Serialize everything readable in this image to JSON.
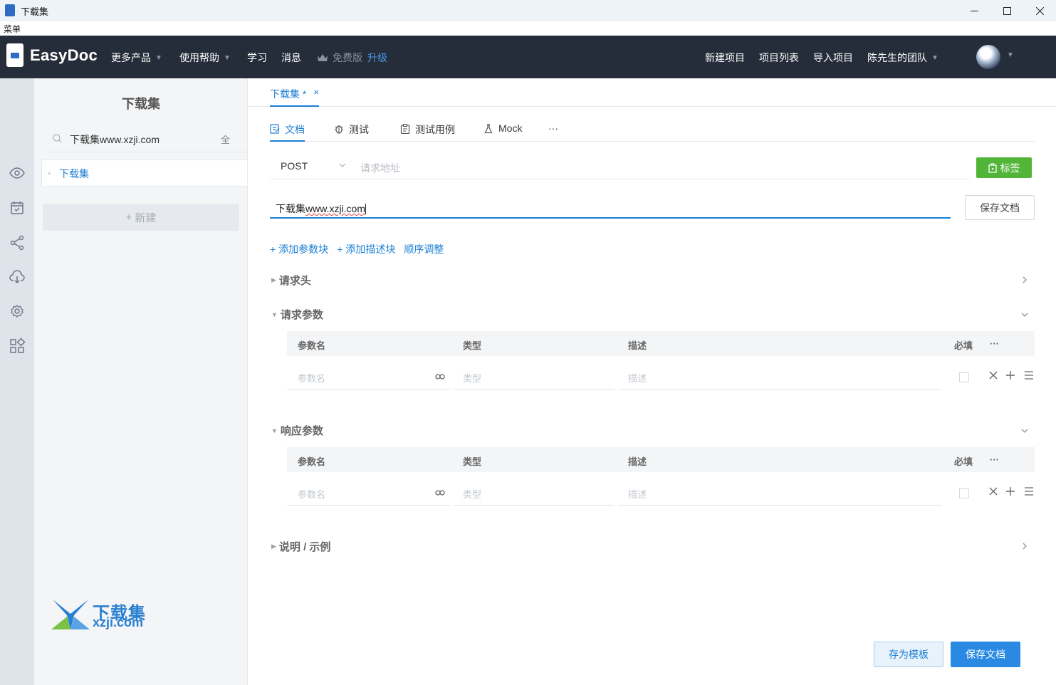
{
  "window": {
    "title": "下载集",
    "menu_label": "菜单"
  },
  "topnav": {
    "brand": "EasyDoc",
    "left_items": [
      {
        "label": "更多产品",
        "dropdown": true
      },
      {
        "label": "使用帮助",
        "dropdown": true
      },
      {
        "label": "学习"
      },
      {
        "label": "消息"
      }
    ],
    "plan_label": "免费版",
    "upgrade_label": "升级",
    "right_items": [
      {
        "label": "新建项目"
      },
      {
        "label": "项目列表"
      },
      {
        "label": "导入项目"
      },
      {
        "label": "陈先生的团队",
        "dropdown": true
      }
    ]
  },
  "rail": {
    "icons": [
      "eye-icon",
      "calendar-icon",
      "share-icon",
      "cloud-download-icon",
      "settings-icon",
      "apps-icon"
    ]
  },
  "left_panel": {
    "title": "下载集",
    "search_value": "下载集www.xzji.com",
    "search_all_label": "全",
    "tree": [
      {
        "label": "下载集"
      }
    ],
    "new_button": "新建",
    "watermark_line1": "下载集",
    "watermark_line2": "xzji.com"
  },
  "main": {
    "doc_tab": {
      "label": "下载集 *",
      "close": "×"
    },
    "subtabs": [
      {
        "label": "文档",
        "icon": "edit-doc-icon",
        "active": true
      },
      {
        "label": "测试",
        "icon": "bug-icon"
      },
      {
        "label": "测试用例",
        "icon": "clipboard-icon"
      },
      {
        "label": "Mock",
        "icon": "flask-icon"
      },
      {
        "label": "···",
        "icon": "more-icon"
      }
    ],
    "method": "POST",
    "url_placeholder": "请求地址",
    "tag_button": "标签",
    "doc_title_prefix": "下载集",
    "doc_title_suffix": "www.xzji.com",
    "save_doc_top": "保存文档",
    "actions": [
      "添加参数块",
      "添加描述块",
      "顺序调整"
    ],
    "sections": {
      "request_headers": "请求头",
      "request_params": "请求参数",
      "response_params": "响应参数",
      "notes": "说明 / 示例"
    },
    "table_headers": {
      "name": "参数名",
      "type": "类型",
      "desc": "描述",
      "required": "必填",
      "more": "···"
    },
    "row_placeholders": {
      "name": "参数名",
      "type": "类型",
      "desc": "描述"
    },
    "save_template": "存为模板",
    "save_doc_bottom": "保存文档"
  },
  "colors": {
    "accent": "#1a7fd4",
    "nav_bg": "#252c3a",
    "tag_green": "#52b538"
  }
}
